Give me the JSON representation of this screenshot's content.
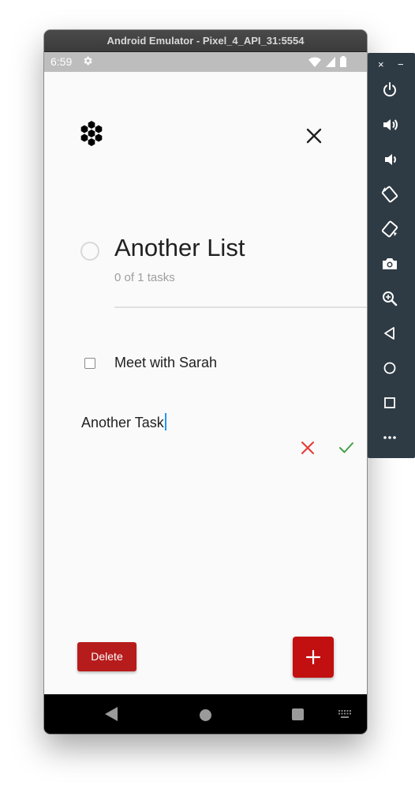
{
  "window": {
    "title": "Android Emulator - Pixel_4_API_31:5554"
  },
  "status_bar": {
    "time": "6:59",
    "icons": [
      "gear-icon",
      "wifi-icon",
      "cellular-icon",
      "battery-icon"
    ]
  },
  "app": {
    "logo_icon": "hexagon-cluster-icon",
    "close_icon": "close-icon",
    "list": {
      "title": "Another List",
      "subtitle": "0 of 1 tasks"
    },
    "tasks": [
      {
        "label": "Meet with Sarah",
        "checked": false
      }
    ],
    "new_task": {
      "value": "Another Task"
    },
    "delete_label": "Delete",
    "add_label": "+",
    "colors": {
      "accent": "#c20f0f",
      "cancel": "#e53935",
      "confirm": "#43a047",
      "caret": "#2196f3"
    }
  },
  "nav_bar": {
    "icons": [
      "back-icon",
      "home-icon",
      "recents-icon",
      "keyboard-icon"
    ]
  },
  "toolbar": {
    "top": {
      "close": "×",
      "minimize": "−"
    },
    "buttons": [
      "power-icon",
      "volume-up-icon",
      "volume-down-icon",
      "rotate-left-icon",
      "rotate-right-icon",
      "camera-icon",
      "zoom-icon",
      "back-icon",
      "home-icon",
      "overview-icon",
      "more-icon"
    ]
  }
}
